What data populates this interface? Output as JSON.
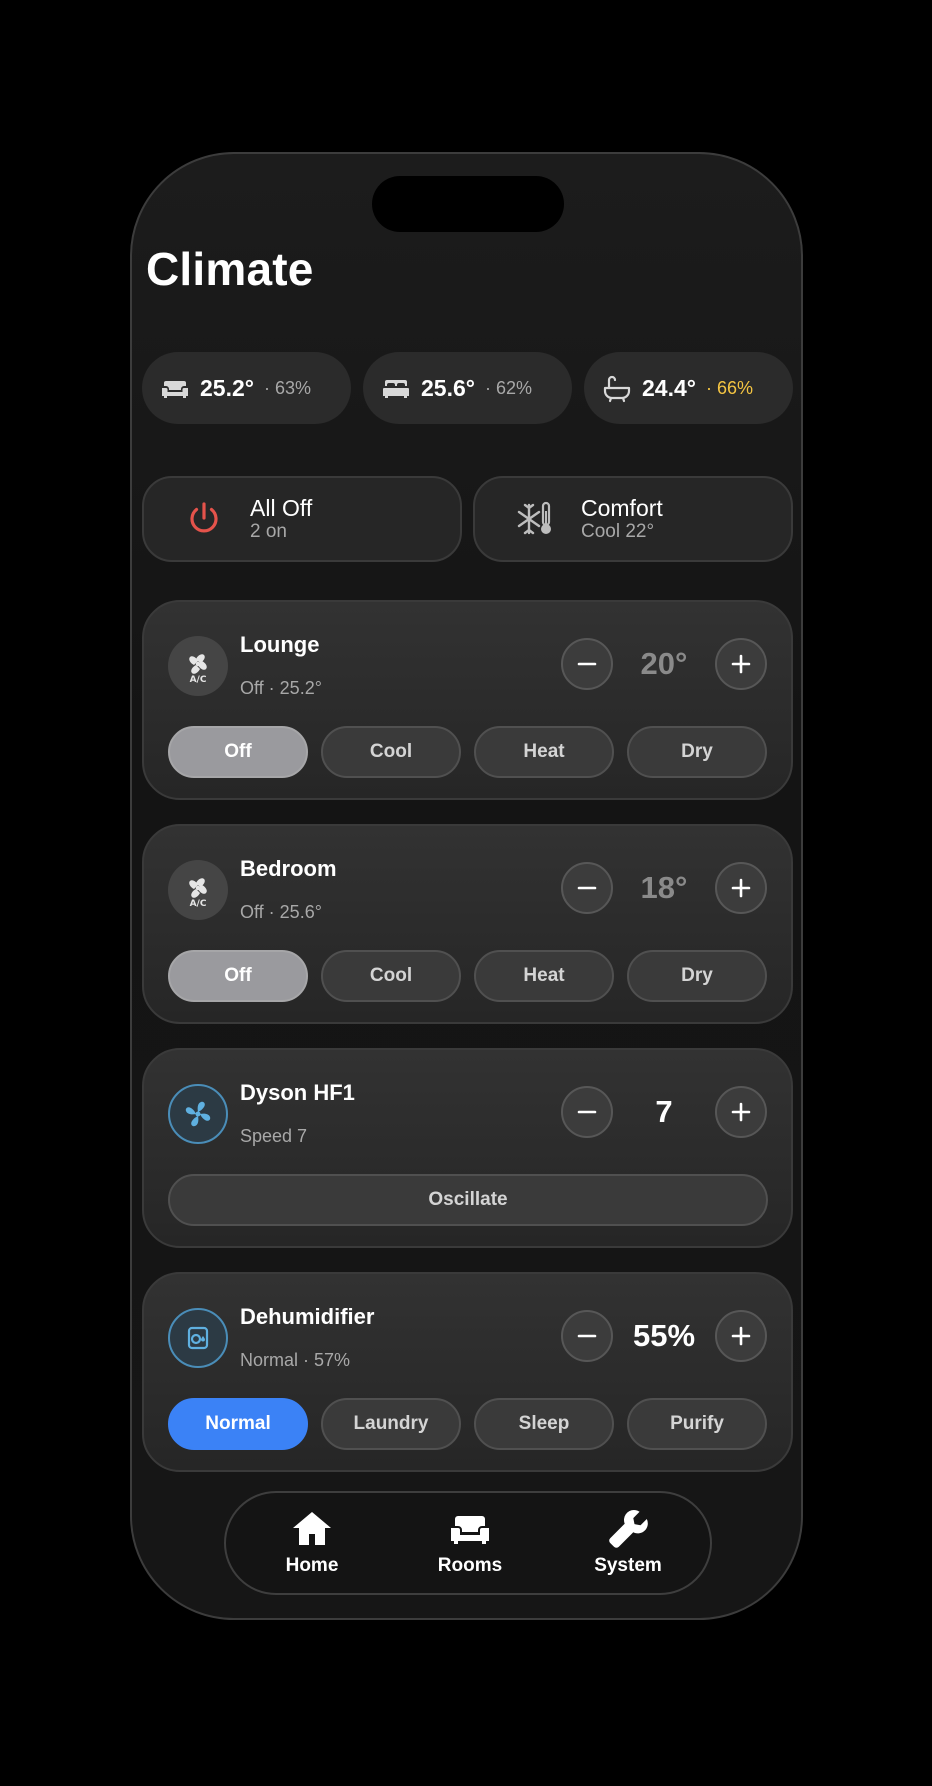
{
  "page": {
    "title": "Climate"
  },
  "sensors": [
    {
      "icon": "sofa-icon",
      "temp": "25.2°",
      "humidity": "· 63%",
      "warn": false
    },
    {
      "icon": "bed-icon",
      "temp": "25.6°",
      "humidity": "· 62%",
      "warn": false
    },
    {
      "icon": "bathtub-icon",
      "temp": "24.4°",
      "humidity": "· 66%",
      "warn": true
    }
  ],
  "scenes": [
    {
      "icon": "power-icon",
      "title": "All Off",
      "subtitle": "2 on"
    },
    {
      "icon": "snowflake-thermometer-icon",
      "title": "Comfort",
      "subtitle": "Cool 22°"
    }
  ],
  "devices": [
    {
      "name": "Lounge",
      "status": "Off · 25.2°",
      "icon": "ac-icon",
      "value": "20°",
      "value_dim": true,
      "modes": [
        "Off",
        "Cool",
        "Heat",
        "Dry"
      ],
      "selected_mode": "Off"
    },
    {
      "name": "Bedroom",
      "status": "Off · 25.6°",
      "icon": "ac-icon",
      "value": "18°",
      "value_dim": true,
      "modes": [
        "Off",
        "Cool",
        "Heat",
        "Dry"
      ],
      "selected_mode": "Off"
    },
    {
      "name": "Dyson HF1",
      "status": "Speed 7",
      "icon": "fan-icon",
      "value": "7",
      "value_dim": false,
      "toggle": "Oscillate"
    },
    {
      "name": "Dehumidifier",
      "status": "Normal · 57%",
      "icon": "dehumidifier-icon",
      "value": "55%",
      "value_dim": false,
      "modes": [
        "Normal",
        "Laundry",
        "Sleep",
        "Purify"
      ],
      "selected_mode": "Normal"
    }
  ],
  "nav": [
    {
      "icon": "home-icon",
      "label": "Home"
    },
    {
      "icon": "sofa-icon",
      "label": "Rooms"
    },
    {
      "icon": "wrench-icon",
      "label": "System"
    }
  ],
  "colors": {
    "accent": "#3b82f6",
    "power": "#e5534b",
    "warning": "#f5c542",
    "device_blue": "#4a8db8"
  }
}
